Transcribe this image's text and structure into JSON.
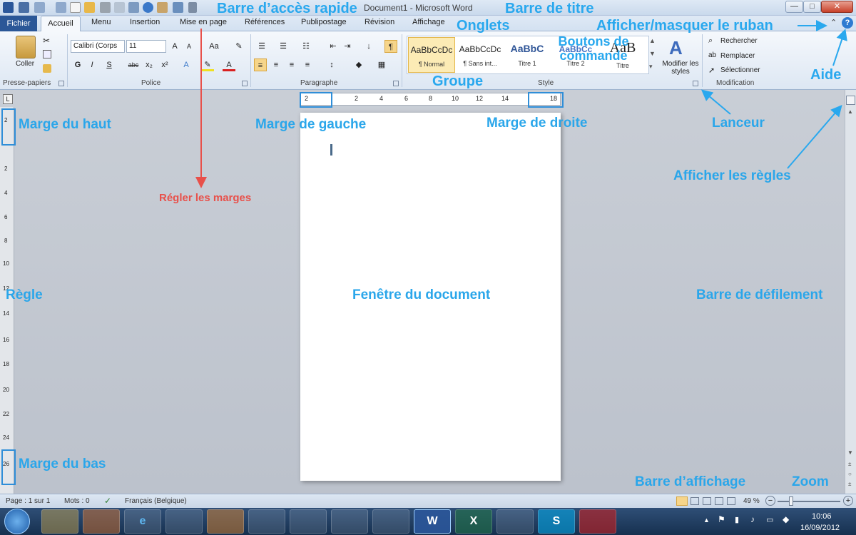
{
  "window": {
    "title": "Document1 - Microsoft Word",
    "min_label": "—",
    "max_label": "□",
    "close_label": "✕"
  },
  "tabs": [
    {
      "label": "Fichier"
    },
    {
      "label": "Accueil"
    },
    {
      "label": "Menu"
    },
    {
      "label": "Insertion"
    },
    {
      "label": "Mise en page"
    },
    {
      "label": "Références"
    },
    {
      "label": "Publipostage"
    },
    {
      "label": "Révision"
    },
    {
      "label": "Affichage"
    }
  ],
  "ribbon": {
    "clipboard": {
      "paste_label": "Coller",
      "group_label": "Presse-papiers"
    },
    "font": {
      "font_name": "Calibri (Corps",
      "font_size": "11",
      "group_label": "Police"
    },
    "paragraph": {
      "group_label": "Paragraphe"
    },
    "styles": {
      "group_label": "Style",
      "items": [
        {
          "preview": "AaBbCcDc",
          "name": "¶ Normal"
        },
        {
          "preview": "AaBbCcDc",
          "name": "¶ Sans int..."
        },
        {
          "preview": "AaBbC",
          "name": "Titre 1"
        },
        {
          "preview": "AaBbCc",
          "name": "Titre 2"
        },
        {
          "preview": "AaB",
          "name": "Titre"
        }
      ],
      "modify_label": "Modifier les styles"
    },
    "editing": {
      "group_label": "Modification",
      "find_label": "Rechercher",
      "replace_label": "Remplacer",
      "select_label": "Sélectionner"
    }
  },
  "ruler": {
    "h_ticks": [
      "2",
      "2",
      "4",
      "6",
      "8",
      "10",
      "12",
      "14",
      "18"
    ],
    "v_ticks": [
      "2",
      "2",
      "4",
      "6",
      "8",
      "10",
      "12",
      "14",
      "16",
      "18",
      "20",
      "22",
      "24",
      "26"
    ]
  },
  "status": {
    "page": "Page : 1 sur 1",
    "words": "Mots : 0",
    "language": "Français (Belgique)",
    "zoom": "49 %"
  },
  "taskbar": {
    "time": "10:06",
    "date": "16/09/2012"
  },
  "annotations": {
    "quick_access": "Barre d’accès rapide",
    "title_bar": "Barre de titre",
    "tabs": "Onglets",
    "toggle_ribbon": "Afficher/masquer le ruban",
    "command_buttons": "Boutons de commande",
    "group": "Groupe",
    "help": "Aide",
    "launcher": "Lanceur",
    "show_rulers": "Afficher les règles",
    "top_margin": "Marge du haut",
    "left_margin": "Marge de gauche",
    "right_margin": "Marge de droite",
    "set_margins": "Régler les marges",
    "ruler": "Règle",
    "document_window": "Fenêtre du document",
    "scrollbar": "Barre de défilement",
    "bottom_margin": "Marge du bas",
    "view_bar": "Barre d’affichage",
    "zoom": "Zoom"
  },
  "colors": {
    "annotation_blue": "#29a8ee",
    "annotation_red": "#e8504a",
    "file_tab": "#2b5797"
  }
}
